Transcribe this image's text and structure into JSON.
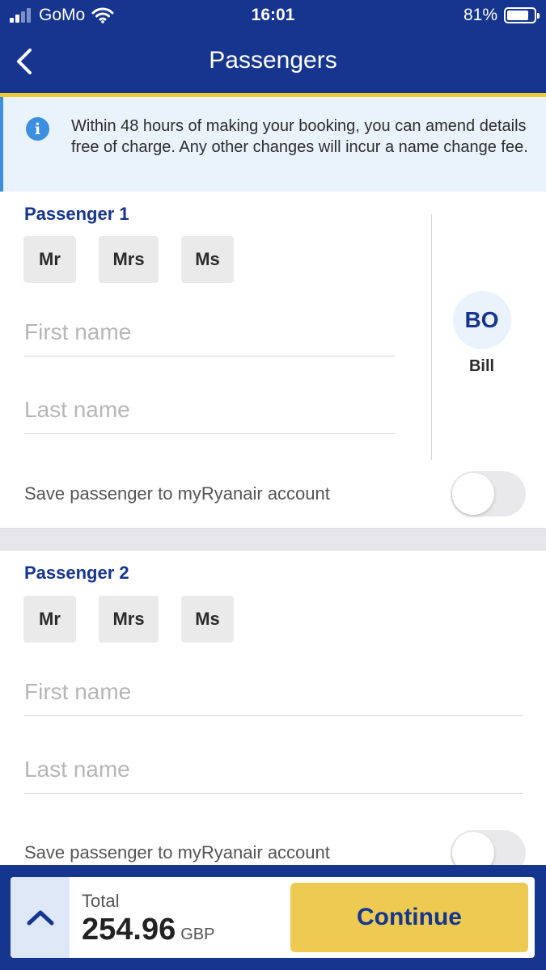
{
  "status_bar": {
    "carrier": "GoMo",
    "time": "16:01",
    "battery": "81%",
    "battery_level": 0.81
  },
  "header": {
    "title": "Passengers",
    "back_icon": "chevron-left-icon"
  },
  "info_banner": {
    "icon": "info-icon",
    "text": "Within 48 hours of making your booking, you can amend details free of charge. Any other changes will incur a name change fee."
  },
  "passengers": [
    {
      "heading": "Passenger 1",
      "titles": [
        "Mr",
        "Mrs",
        "Ms"
      ],
      "first_name_placeholder": "First name",
      "last_name_placeholder": "Last name",
      "first_name_value": "",
      "last_name_value": "",
      "save_label": "Save passenger to myRyanair account",
      "save_enabled": false,
      "saved_passenger": {
        "initials": "BO",
        "name": "Bill"
      }
    },
    {
      "heading": "Passenger 2",
      "titles": [
        "Mr",
        "Mrs",
        "Ms"
      ],
      "first_name_placeholder": "First name",
      "last_name_placeholder": "Last name",
      "first_name_value": "",
      "last_name_value": "",
      "save_label": "Save passenger to myRyanair account",
      "save_enabled": false
    }
  ],
  "footer": {
    "expand_icon": "chevron-up-icon",
    "total_label": "Total",
    "total_amount": "254.96",
    "currency": "GBP",
    "continue_label": "Continue"
  },
  "colors": {
    "brand_blue": "#16358f",
    "accent_yellow": "#f1c933",
    "button_yellow": "#edcb52",
    "info_blue": "#3b8fe0",
    "info_bg": "#eaf2fb"
  }
}
